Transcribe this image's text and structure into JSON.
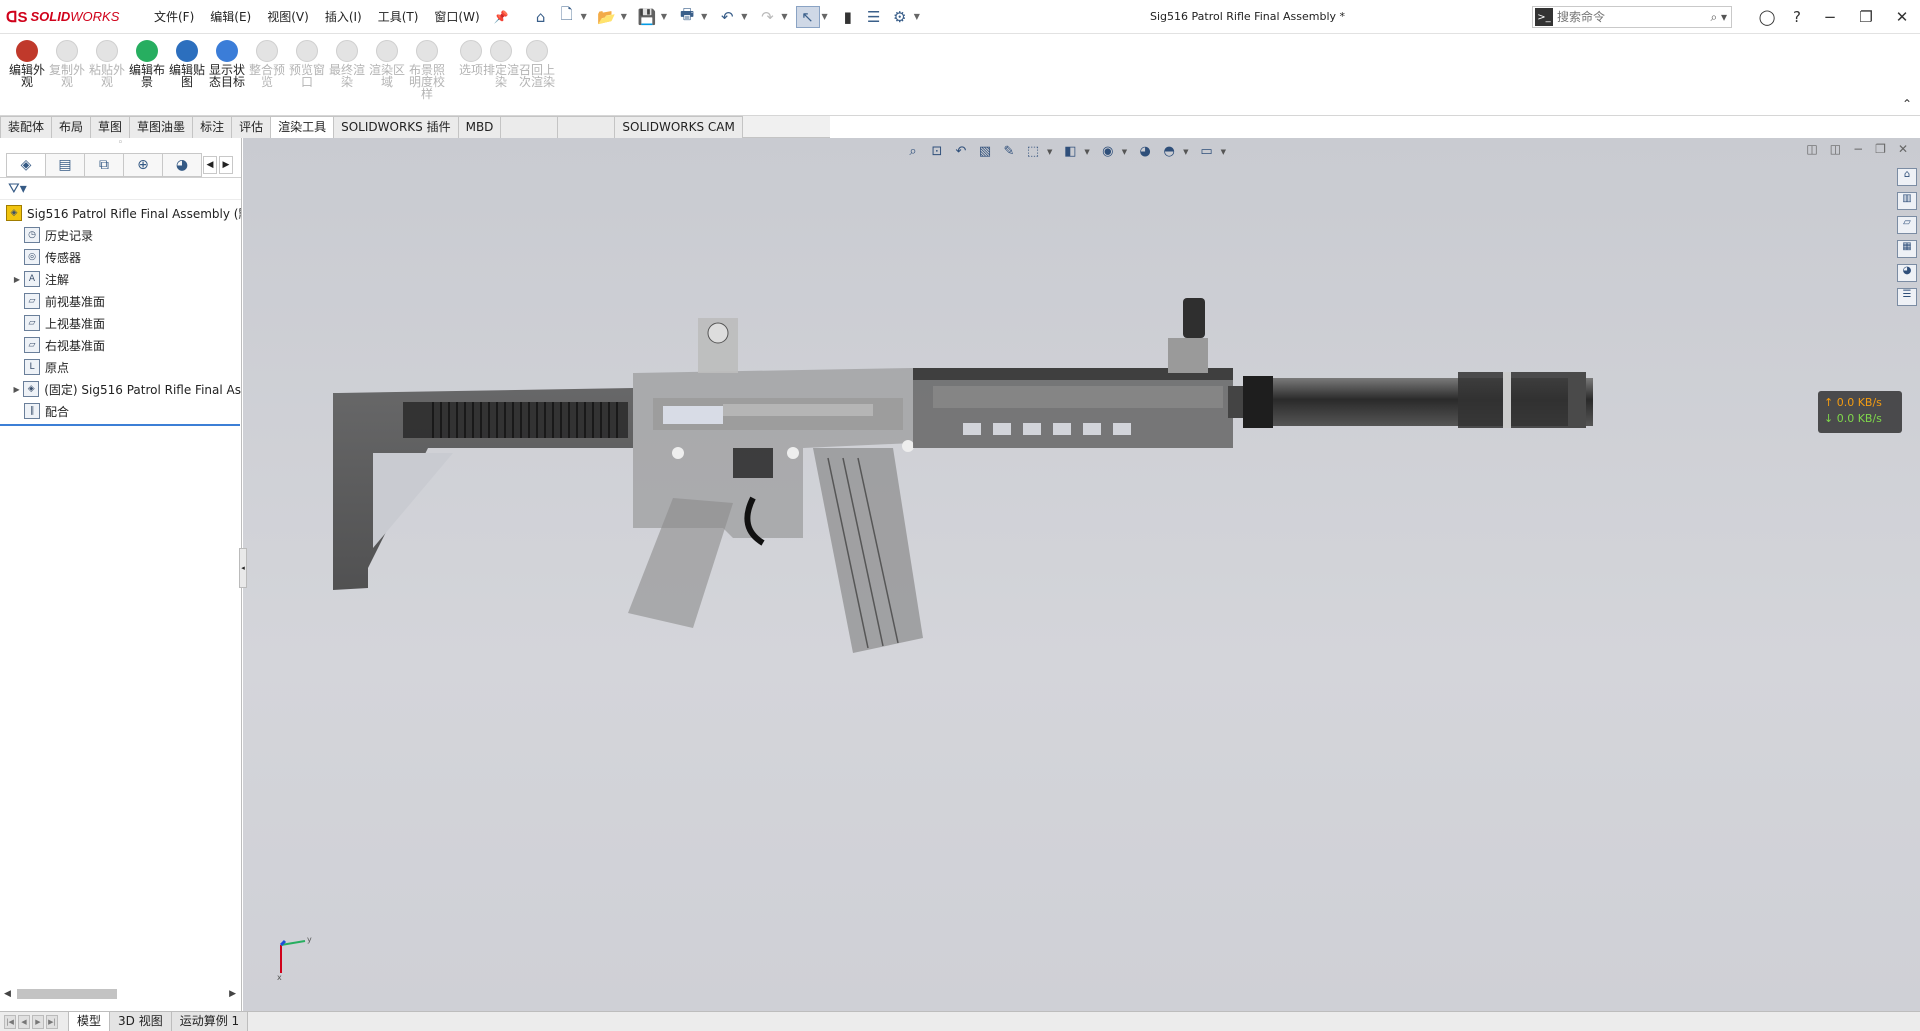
{
  "app": {
    "logo_text_solid": "SOLID",
    "logo_text_works": "WORKS",
    "document_title": "Sig516 Patrol Rifle Final Assembly *"
  },
  "menu": [
    "文件(F)",
    "编辑(E)",
    "视图(V)",
    "插入(I)",
    "工具(T)",
    "窗口(W)"
  ],
  "search": {
    "placeholder": "搜索命令"
  },
  "command_manager": [
    {
      "label": "编辑外观",
      "enabled": true,
      "color": "#c0392b"
    },
    {
      "label": "复制外观",
      "enabled": false
    },
    {
      "label": "粘贴外观",
      "enabled": false
    },
    {
      "label": "编辑布景",
      "enabled": true,
      "color": "#27ae60"
    },
    {
      "label": "编辑贴图",
      "enabled": true,
      "color": "#2c6fbe"
    },
    {
      "label": "显示状态目标",
      "enabled": true,
      "color": "#3b7dd8"
    },
    {
      "label": "整合预览",
      "enabled": false
    },
    {
      "label": "预览窗口",
      "enabled": false
    },
    {
      "label": "最终渲染",
      "enabled": false
    },
    {
      "label": "渲染区域",
      "enabled": false
    },
    {
      "label": "布景照明度校样",
      "enabled": false
    },
    {
      "label": "选项",
      "enabled": false
    },
    {
      "label": "排定渲染",
      "enabled": false
    },
    {
      "label": "召回上次渲染",
      "enabled": false
    }
  ],
  "tabs": [
    {
      "label": "装配体",
      "active": false
    },
    {
      "label": "布局",
      "active": false
    },
    {
      "label": "草图",
      "active": false
    },
    {
      "label": "草图油墨",
      "active": false
    },
    {
      "label": "标注",
      "active": false
    },
    {
      "label": "评估",
      "active": false
    },
    {
      "label": "渲染工具",
      "active": true
    },
    {
      "label": "SOLIDWORKS 插件",
      "active": false
    },
    {
      "label": "MBD",
      "active": false
    },
    {
      "label": "",
      "active": false
    },
    {
      "label": "",
      "active": false
    },
    {
      "label": "SOLIDWORKS CAM",
      "active": false
    }
  ],
  "feature_tree": {
    "root": "Sig516 Patrol Rifle Final Assembly (默",
    "items": [
      {
        "label": "历史记录",
        "expandable": false,
        "icon": "history-icon",
        "glyph": "◷"
      },
      {
        "label": "传感器",
        "expandable": false,
        "icon": "sensor-icon",
        "glyph": "◎"
      },
      {
        "label": "注解",
        "expandable": true,
        "icon": "annotation-icon",
        "glyph": "A"
      },
      {
        "label": "前视基准面",
        "expandable": false,
        "icon": "plane-icon",
        "glyph": "▱"
      },
      {
        "label": "上视基准面",
        "expandable": false,
        "icon": "plane-icon",
        "glyph": "▱"
      },
      {
        "label": "右视基准面",
        "expandable": false,
        "icon": "plane-icon",
        "glyph": "▱"
      },
      {
        "label": "原点",
        "expandable": false,
        "icon": "origin-icon",
        "glyph": "L"
      },
      {
        "label": "(固定) Sig516 Patrol Rifle Final As",
        "expandable": true,
        "icon": "subassembly-icon",
        "glyph": "◈"
      },
      {
        "label": "配合",
        "expandable": false,
        "icon": "mates-icon",
        "glyph": "∥"
      }
    ]
  },
  "net_speed": {
    "up": "↑ 0.0 KB/s",
    "down": "↓ 0.0 KB/s"
  },
  "triad": {
    "x": "x",
    "y": "y"
  },
  "bottom_tabs": [
    {
      "label": "模型",
      "active": true
    },
    {
      "label": "3D 视图",
      "active": false
    },
    {
      "label": "运动算例 1",
      "active": false
    }
  ]
}
